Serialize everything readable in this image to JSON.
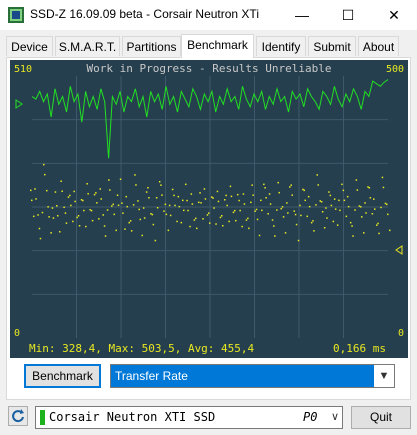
{
  "window": {
    "title": "SSD-Z 16.09.09 beta - Corsair Neutron XTi",
    "minimize_glyph": "—",
    "maximize_glyph": "☐",
    "close_glyph": "✕"
  },
  "tabs": [
    {
      "label": "Device"
    },
    {
      "label": "S.M.A.R.T."
    },
    {
      "label": "Partitions"
    },
    {
      "label": "Benchmark"
    },
    {
      "label": "Identify"
    },
    {
      "label": "Submit"
    },
    {
      "label": "About"
    }
  ],
  "active_tab": "Benchmark",
  "benchmark": {
    "banner": "Work in Progress - Results Unreliable",
    "y_max_left": "510",
    "y_max_right": "500",
    "y_min_left": "0",
    "y_min_right": "0",
    "stats": "Min: 328,4, Max: 503,5, Avg: 455,4",
    "latency": "0,166 ms",
    "button_label": "Benchmark",
    "selected_mode": "Transfer Rate",
    "colors": {
      "background": "#253f4f",
      "line": "#22e022",
      "dots": "#e8e820",
      "grid": "#3e5a6a",
      "text": "#c8c8c8"
    }
  },
  "chart_data": {
    "type": "line",
    "title": "Work in Progress - Results Unreliable",
    "ylim_left": [
      0,
      510
    ],
    "ylim_right": [
      0,
      500
    ],
    "grid": true,
    "series": [
      {
        "values": [
          470,
          465,
          480,
          460,
          475,
          430,
          485,
          455,
          470,
          440,
          490,
          460,
          475,
          420,
          480,
          450,
          470,
          445,
          485,
          460,
          350,
          470,
          455,
          480,
          440,
          470,
          460,
          485,
          450,
          470,
          430,
          480,
          460,
          475,
          445,
          490,
          455,
          470,
          440,
          480,
          465,
          450,
          485,
          470,
          445,
          475,
          460,
          480,
          440,
          470,
          455,
          485,
          460,
          470,
          445,
          490,
          465,
          450,
          475,
          460,
          480,
          445,
          470,
          455,
          485,
          460,
          470,
          440,
          480,
          465,
          475,
          450,
          485,
          470,
          460,
          445,
          480,
          470,
          455,
          490,
          465,
          450,
          475,
          460,
          485,
          470,
          445,
          480,
          470,
          500,
          495,
          490,
          498,
          503
        ]
      },
      {
        "values": [
          250,
          280,
          230,
          300,
          245,
          270,
          220,
          295,
          260,
          240,
          275,
          255,
          230,
          290,
          265,
          245,
          280,
          235,
          270,
          250,
          295,
          225,
          265,
          245,
          280,
          240,
          270,
          255,
          230,
          290,
          260,
          250,
          275,
          240,
          265,
          285,
          230,
          270,
          250,
          245,
          280,
          260,
          235,
          275,
          255,
          240,
          285,
          265,
          230,
          270,
          250,
          260,
          240,
          285,
          255,
          270,
          235,
          265,
          245,
          280,
          260,
          230,
          275,
          250,
          265,
          245,
          280,
          255,
          270,
          240,
          260,
          285,
          250,
          265,
          235,
          270,
          245,
          280,
          255,
          260,
          240,
          275,
          250
        ]
      }
    ]
  },
  "drive": {
    "name": "Corsair Neutron XTI SSD",
    "port": "P0",
    "status_color": "#1fb21f"
  },
  "buttons": {
    "quit_label": "Quit"
  }
}
